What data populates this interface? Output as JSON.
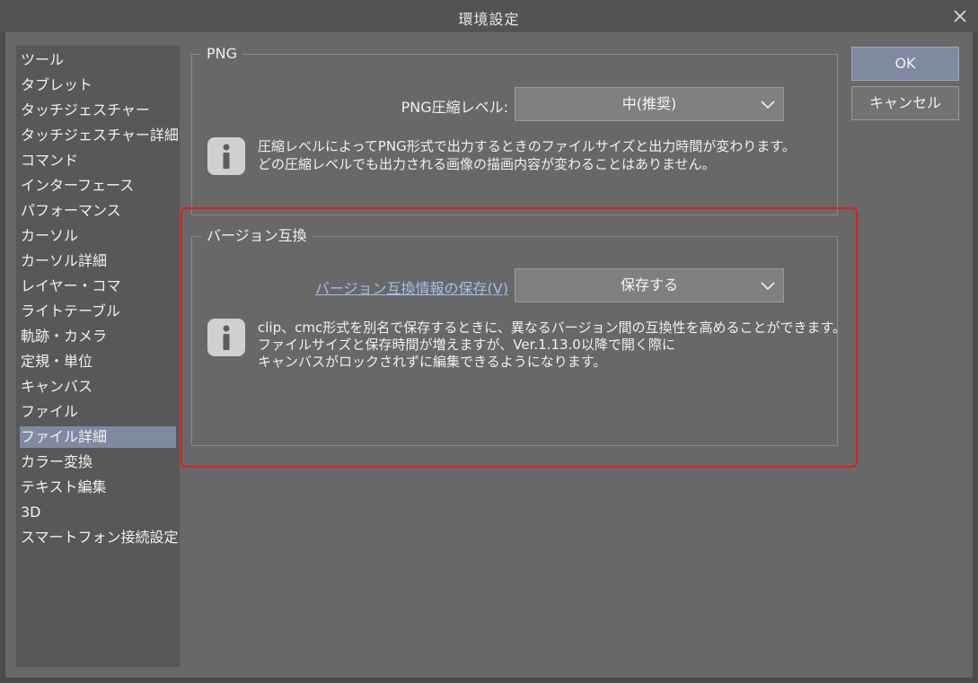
{
  "window": {
    "title": "環境設定"
  },
  "sidebar": {
    "items": [
      {
        "label": "ツール"
      },
      {
        "label": "タブレット"
      },
      {
        "label": "タッチジェスチャー"
      },
      {
        "label": "タッチジェスチャー詳細"
      },
      {
        "label": "コマンド"
      },
      {
        "label": "インターフェース"
      },
      {
        "label": "パフォーマンス"
      },
      {
        "label": "カーソル"
      },
      {
        "label": "カーソル詳細"
      },
      {
        "label": "レイヤー・コマ"
      },
      {
        "label": "ライトテーブル"
      },
      {
        "label": "軌跡・カメラ"
      },
      {
        "label": "定規・単位"
      },
      {
        "label": "キャンバス"
      },
      {
        "label": "ファイル"
      },
      {
        "label": "ファイル詳細",
        "selected": true
      },
      {
        "label": "カラー変換"
      },
      {
        "label": "テキスト編集"
      },
      {
        "label": "3D"
      },
      {
        "label": "スマートフォン接続設定"
      }
    ]
  },
  "png_group": {
    "title": "PNG",
    "compression_label": "PNG圧縮レベル:",
    "compression_value": "中(推奨)",
    "info_line1": "圧縮レベルによってPNG形式で出力するときのファイルサイズと出力時間が変わります。",
    "info_line2": "どの圧縮レベルでも出力される画像の描画内容が変わることはありません。"
  },
  "version_group": {
    "title": "バージョン互換",
    "save_label": "バージョン互換情報の保存(V)",
    "save_value": "保存する",
    "info_line1": "clip、cmc形式を別名で保存するときに、異なるバージョン間の互換性を高めることができます。",
    "info_line2": "ファイルサイズと保存時間が増えますが、Ver.1.13.0以降で開く際に",
    "info_line3": "キャンバスがロックされずに編集できるようになります。"
  },
  "buttons": {
    "ok": "OK",
    "cancel": "キャンセル"
  },
  "colors": {
    "selection": "#7f8aa2",
    "highlight_border": "#e01e1e",
    "link": "#9fc1ea"
  },
  "icons": {
    "close": "close-icon",
    "info": "info-icon",
    "chevron": "chevron-down-icon"
  }
}
